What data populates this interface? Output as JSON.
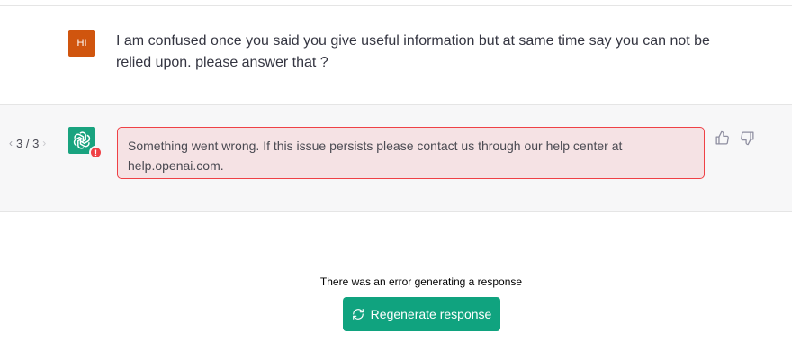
{
  "user_message": {
    "avatar_initials": "HI",
    "text": "I am confused once you said you give useful information but at same time say you can not be relied upon. please answer that ?"
  },
  "assistant_message": {
    "pager": {
      "prev_icon": "chevron-left-icon",
      "label": "3 / 3",
      "next_icon": "chevron-right-icon"
    },
    "avatar_icon": "openai-logo-icon",
    "error_badge": "!",
    "error_text": "Something went wrong. If this issue persists please contact us through our help center at help.openai.com.",
    "feedback": {
      "thumbs_up_icon": "thumbs-up-icon",
      "thumbs_down_icon": "thumbs-down-icon"
    }
  },
  "footer": {
    "error_note": "There was an error generating a response",
    "regenerate_label": "Regenerate response",
    "regenerate_icon": "refresh-icon"
  },
  "colors": {
    "user_avatar": "#d0550e",
    "bot_avatar": "#19a37f",
    "error_border": "#ef4146",
    "error_bg": "#f5e2e4",
    "button": "#10a37f"
  }
}
